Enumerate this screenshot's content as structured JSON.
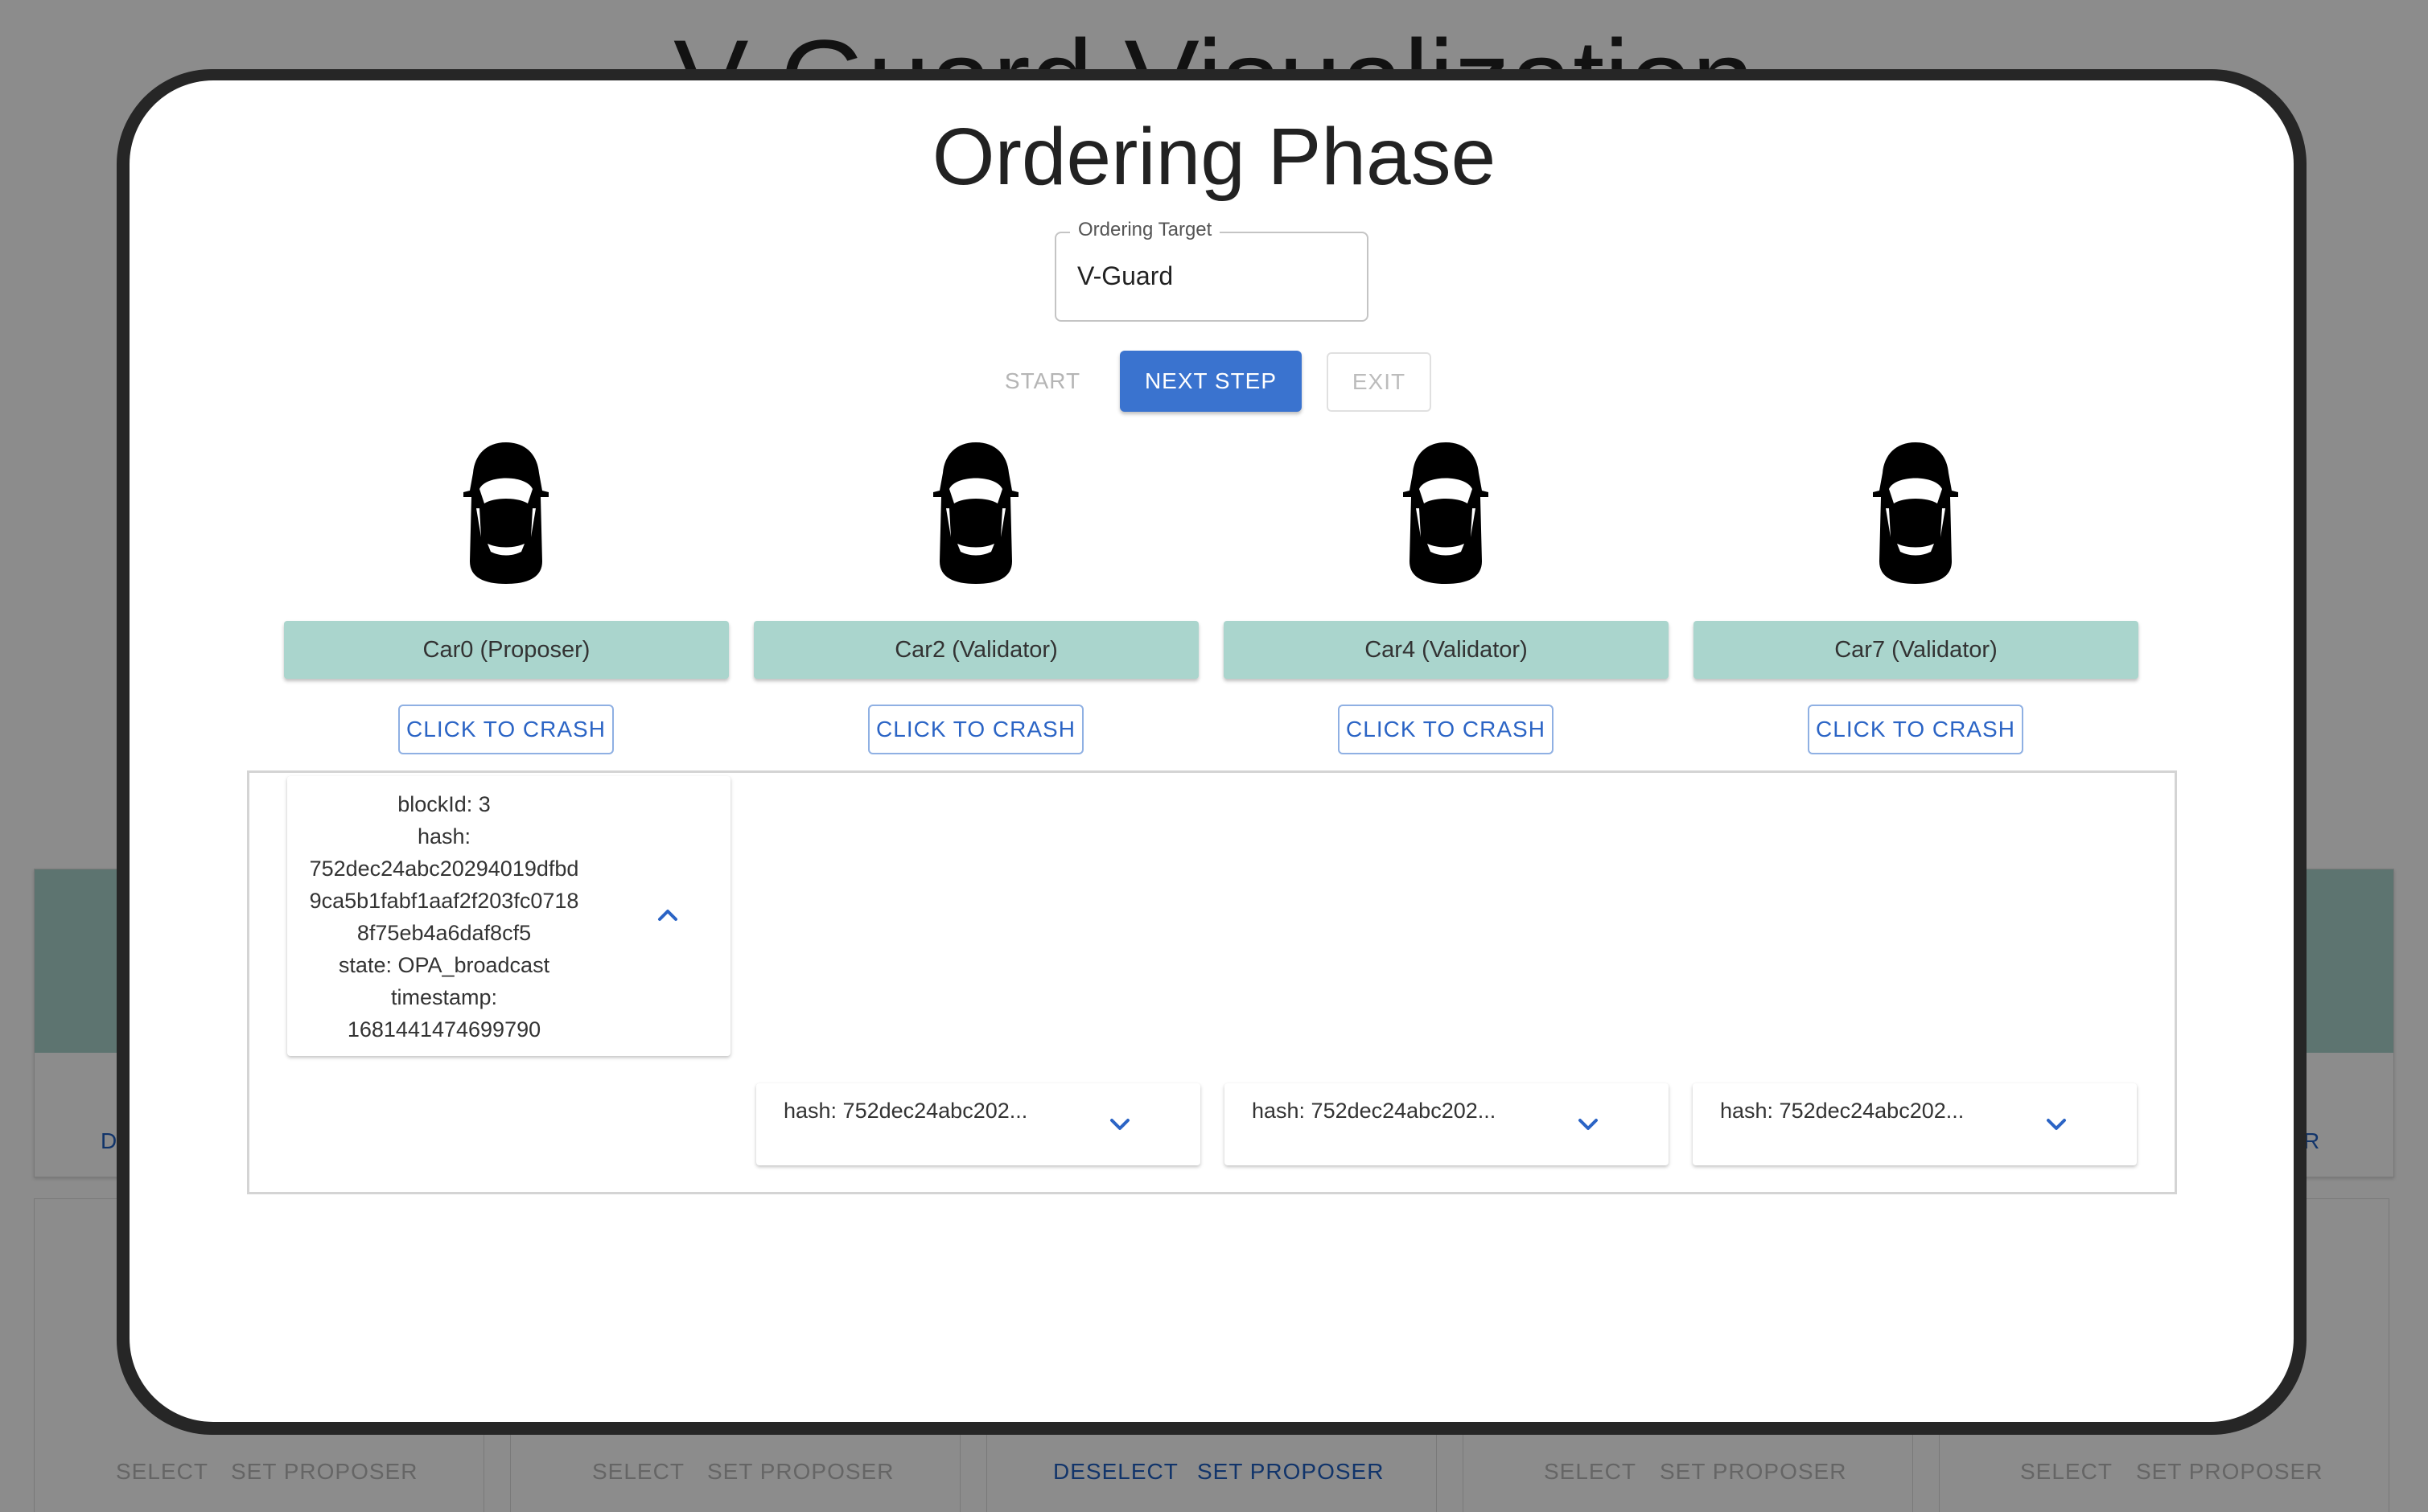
{
  "background": {
    "title": "V-Guard Visualization",
    "cards_top": [
      {
        "left_action": "D",
        "right_action": ""
      },
      {
        "left_action": "",
        "right_action": "R"
      }
    ],
    "bottom_cards": [
      {
        "select": "SELECT",
        "set_proposer": "SET PROPOSER",
        "active": false
      },
      {
        "select": "SELECT",
        "set_proposer": "SET PROPOSER",
        "active": false
      },
      {
        "select": "DESELECT",
        "set_proposer": "SET PROPOSER",
        "active": true
      },
      {
        "select": "SELECT",
        "set_proposer": "SET PROPOSER",
        "active": false
      },
      {
        "select": "SELECT",
        "set_proposer": "SET PROPOSER",
        "active": false
      }
    ]
  },
  "modal": {
    "title": "Ordering Phase",
    "ordering_target": {
      "label": "Ordering Target",
      "value": "V-Guard"
    },
    "controls": {
      "start": "START",
      "next_step": "NEXT STEP",
      "exit": "EXIT"
    },
    "cars": [
      {
        "label": "Car0 (Proposer)",
        "crash": "CLICK TO CRASH"
      },
      {
        "label": "Car2 (Validator)",
        "crash": "CLICK TO CRASH"
      },
      {
        "label": "Car4 (Validator)",
        "crash": "CLICK TO CRASH"
      },
      {
        "label": "Car7 (Validator)",
        "crash": "CLICK TO CRASH"
      }
    ],
    "expanded_block": {
      "lines": [
        "blockId: 3",
        "hash:",
        "752dec24abc20294019dfbd",
        "9ca5b1fabf1aaf2f203fc0718",
        "8f75eb4a6daf8cf5",
        "state: OPA_broadcast",
        "timestamp:",
        "1681441474699790"
      ]
    },
    "collapsed_blocks": [
      {
        "text": "hash: 752dec24abc202..."
      },
      {
        "text": "hash: 752dec24abc202..."
      },
      {
        "text": "hash: 752dec24abc202..."
      }
    ]
  }
}
